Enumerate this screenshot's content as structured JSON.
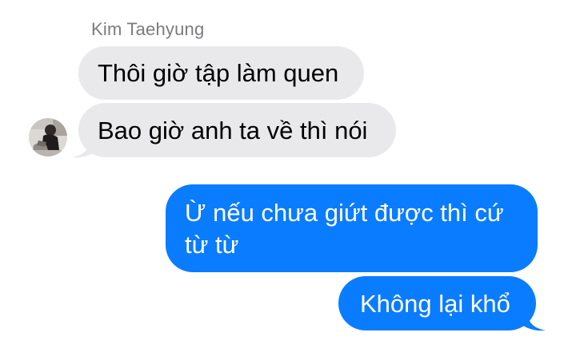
{
  "colors": {
    "incoming_bubble": "#e9e9eb",
    "outgoing_bubble": "#0a7cff",
    "sender_name": "#7b7b80"
  },
  "sender": {
    "name": "Kim Taehyung",
    "avatar_icon": "contact-photo-avatar"
  },
  "messages": [
    {
      "direction": "incoming",
      "text": "Thôi giờ tập làm quen"
    },
    {
      "direction": "incoming",
      "text": "Bao giờ anh ta về thì nói"
    },
    {
      "direction": "outgoing",
      "text": "Ừ nếu chưa giứt được thì cứ từ từ"
    },
    {
      "direction": "outgoing",
      "text": "Không lại khổ"
    }
  ]
}
